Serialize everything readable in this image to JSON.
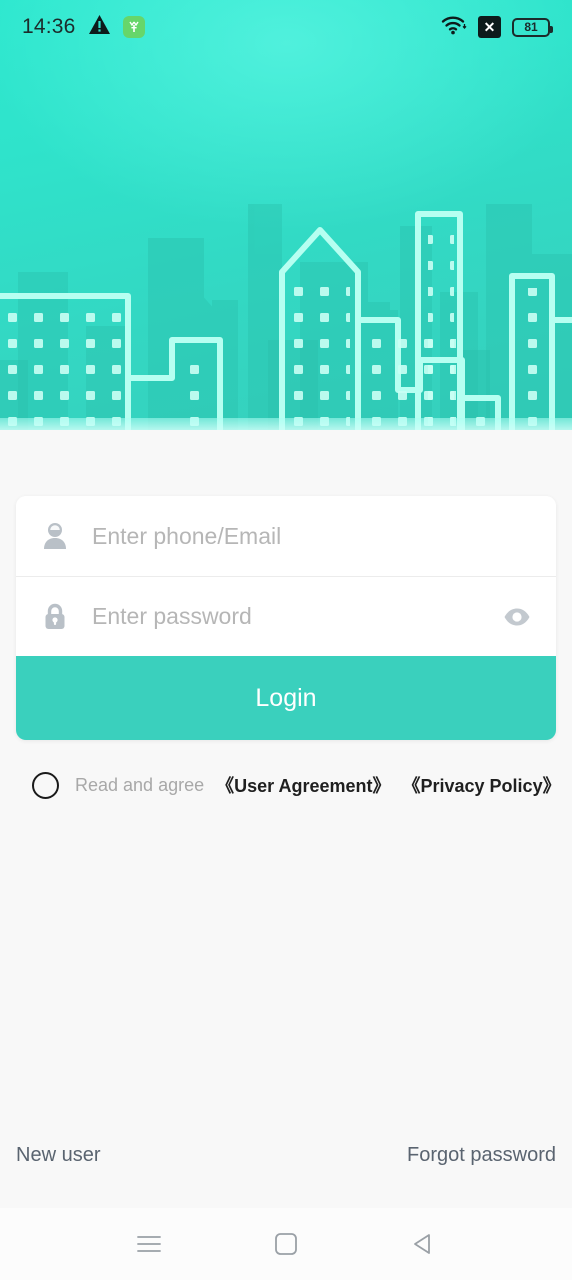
{
  "status_bar": {
    "clock": "14:36",
    "warning_icon": "warning-triangle-icon",
    "app_badge_icon": "green-app-icon",
    "wifi_icon": "wifi-icon",
    "no_sim_icon": "no-sim-icon",
    "no_sim_glyph": "✕",
    "battery_level": "81"
  },
  "hero": {
    "illustration": "city-skyline-illustration",
    "gradient_from": "#2ee8cf",
    "gradient_to": "#36cfbc"
  },
  "form": {
    "username": {
      "icon": "user-icon",
      "value": "",
      "placeholder": "Enter phone/Email"
    },
    "password": {
      "icon": "lock-icon",
      "value": "",
      "placeholder": "Enter password",
      "reveal_icon": "eye-icon"
    },
    "login_label": "Login",
    "login_color": "#3ad0bd"
  },
  "agreement": {
    "checked": false,
    "prefix": "Read and agree",
    "user_agreement": "《User Agreement》",
    "privacy_policy": "《Privacy Policy》"
  },
  "bottom": {
    "new_user": "New user",
    "forgot_password": "Forgot password"
  },
  "nav_bar": {
    "recents_icon": "menu-icon",
    "home_icon": "home-square-icon",
    "back_icon": "back-triangle-icon"
  }
}
